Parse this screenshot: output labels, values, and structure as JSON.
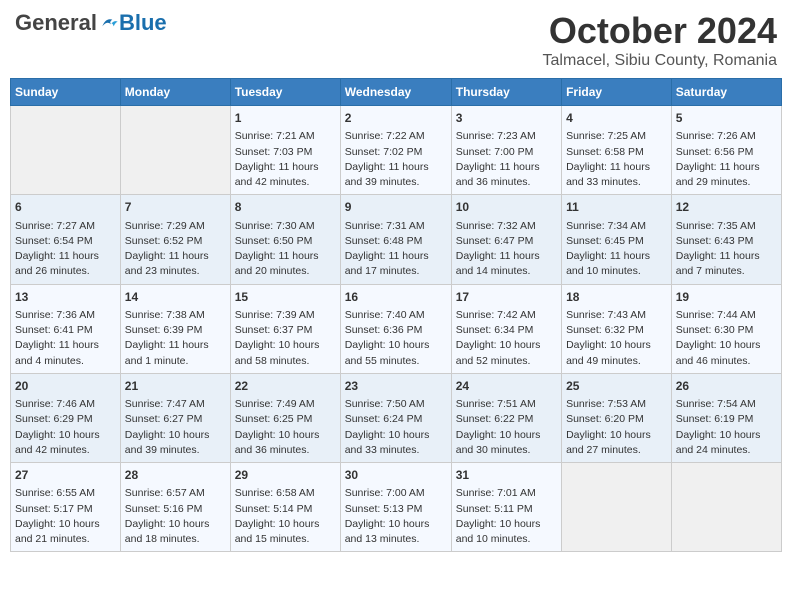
{
  "header": {
    "logo_general": "General",
    "logo_blue": "Blue",
    "month": "October 2024",
    "location": "Talmacel, Sibiu County, Romania"
  },
  "weekdays": [
    "Sunday",
    "Monday",
    "Tuesday",
    "Wednesday",
    "Thursday",
    "Friday",
    "Saturday"
  ],
  "weeks": [
    [
      {
        "day": "",
        "sunrise": "",
        "sunset": "",
        "daylight": ""
      },
      {
        "day": "",
        "sunrise": "",
        "sunset": "",
        "daylight": ""
      },
      {
        "day": "1",
        "sunrise": "Sunrise: 7:21 AM",
        "sunset": "Sunset: 7:03 PM",
        "daylight": "Daylight: 11 hours and 42 minutes."
      },
      {
        "day": "2",
        "sunrise": "Sunrise: 7:22 AM",
        "sunset": "Sunset: 7:02 PM",
        "daylight": "Daylight: 11 hours and 39 minutes."
      },
      {
        "day": "3",
        "sunrise": "Sunrise: 7:23 AM",
        "sunset": "Sunset: 7:00 PM",
        "daylight": "Daylight: 11 hours and 36 minutes."
      },
      {
        "day": "4",
        "sunrise": "Sunrise: 7:25 AM",
        "sunset": "Sunset: 6:58 PM",
        "daylight": "Daylight: 11 hours and 33 minutes."
      },
      {
        "day": "5",
        "sunrise": "Sunrise: 7:26 AM",
        "sunset": "Sunset: 6:56 PM",
        "daylight": "Daylight: 11 hours and 29 minutes."
      }
    ],
    [
      {
        "day": "6",
        "sunrise": "Sunrise: 7:27 AM",
        "sunset": "Sunset: 6:54 PM",
        "daylight": "Daylight: 11 hours and 26 minutes."
      },
      {
        "day": "7",
        "sunrise": "Sunrise: 7:29 AM",
        "sunset": "Sunset: 6:52 PM",
        "daylight": "Daylight: 11 hours and 23 minutes."
      },
      {
        "day": "8",
        "sunrise": "Sunrise: 7:30 AM",
        "sunset": "Sunset: 6:50 PM",
        "daylight": "Daylight: 11 hours and 20 minutes."
      },
      {
        "day": "9",
        "sunrise": "Sunrise: 7:31 AM",
        "sunset": "Sunset: 6:48 PM",
        "daylight": "Daylight: 11 hours and 17 minutes."
      },
      {
        "day": "10",
        "sunrise": "Sunrise: 7:32 AM",
        "sunset": "Sunset: 6:47 PM",
        "daylight": "Daylight: 11 hours and 14 minutes."
      },
      {
        "day": "11",
        "sunrise": "Sunrise: 7:34 AM",
        "sunset": "Sunset: 6:45 PM",
        "daylight": "Daylight: 11 hours and 10 minutes."
      },
      {
        "day": "12",
        "sunrise": "Sunrise: 7:35 AM",
        "sunset": "Sunset: 6:43 PM",
        "daylight": "Daylight: 11 hours and 7 minutes."
      }
    ],
    [
      {
        "day": "13",
        "sunrise": "Sunrise: 7:36 AM",
        "sunset": "Sunset: 6:41 PM",
        "daylight": "Daylight: 11 hours and 4 minutes."
      },
      {
        "day": "14",
        "sunrise": "Sunrise: 7:38 AM",
        "sunset": "Sunset: 6:39 PM",
        "daylight": "Daylight: 11 hours and 1 minute."
      },
      {
        "day": "15",
        "sunrise": "Sunrise: 7:39 AM",
        "sunset": "Sunset: 6:37 PM",
        "daylight": "Daylight: 10 hours and 58 minutes."
      },
      {
        "day": "16",
        "sunrise": "Sunrise: 7:40 AM",
        "sunset": "Sunset: 6:36 PM",
        "daylight": "Daylight: 10 hours and 55 minutes."
      },
      {
        "day": "17",
        "sunrise": "Sunrise: 7:42 AM",
        "sunset": "Sunset: 6:34 PM",
        "daylight": "Daylight: 10 hours and 52 minutes."
      },
      {
        "day": "18",
        "sunrise": "Sunrise: 7:43 AM",
        "sunset": "Sunset: 6:32 PM",
        "daylight": "Daylight: 10 hours and 49 minutes."
      },
      {
        "day": "19",
        "sunrise": "Sunrise: 7:44 AM",
        "sunset": "Sunset: 6:30 PM",
        "daylight": "Daylight: 10 hours and 46 minutes."
      }
    ],
    [
      {
        "day": "20",
        "sunrise": "Sunrise: 7:46 AM",
        "sunset": "Sunset: 6:29 PM",
        "daylight": "Daylight: 10 hours and 42 minutes."
      },
      {
        "day": "21",
        "sunrise": "Sunrise: 7:47 AM",
        "sunset": "Sunset: 6:27 PM",
        "daylight": "Daylight: 10 hours and 39 minutes."
      },
      {
        "day": "22",
        "sunrise": "Sunrise: 7:49 AM",
        "sunset": "Sunset: 6:25 PM",
        "daylight": "Daylight: 10 hours and 36 minutes."
      },
      {
        "day": "23",
        "sunrise": "Sunrise: 7:50 AM",
        "sunset": "Sunset: 6:24 PM",
        "daylight": "Daylight: 10 hours and 33 minutes."
      },
      {
        "day": "24",
        "sunrise": "Sunrise: 7:51 AM",
        "sunset": "Sunset: 6:22 PM",
        "daylight": "Daylight: 10 hours and 30 minutes."
      },
      {
        "day": "25",
        "sunrise": "Sunrise: 7:53 AM",
        "sunset": "Sunset: 6:20 PM",
        "daylight": "Daylight: 10 hours and 27 minutes."
      },
      {
        "day": "26",
        "sunrise": "Sunrise: 7:54 AM",
        "sunset": "Sunset: 6:19 PM",
        "daylight": "Daylight: 10 hours and 24 minutes."
      }
    ],
    [
      {
        "day": "27",
        "sunrise": "Sunrise: 6:55 AM",
        "sunset": "Sunset: 5:17 PM",
        "daylight": "Daylight: 10 hours and 21 minutes."
      },
      {
        "day": "28",
        "sunrise": "Sunrise: 6:57 AM",
        "sunset": "Sunset: 5:16 PM",
        "daylight": "Daylight: 10 hours and 18 minutes."
      },
      {
        "day": "29",
        "sunrise": "Sunrise: 6:58 AM",
        "sunset": "Sunset: 5:14 PM",
        "daylight": "Daylight: 10 hours and 15 minutes."
      },
      {
        "day": "30",
        "sunrise": "Sunrise: 7:00 AM",
        "sunset": "Sunset: 5:13 PM",
        "daylight": "Daylight: 10 hours and 13 minutes."
      },
      {
        "day": "31",
        "sunrise": "Sunrise: 7:01 AM",
        "sunset": "Sunset: 5:11 PM",
        "daylight": "Daylight: 10 hours and 10 minutes."
      },
      {
        "day": "",
        "sunrise": "",
        "sunset": "",
        "daylight": ""
      },
      {
        "day": "",
        "sunrise": "",
        "sunset": "",
        "daylight": ""
      }
    ]
  ]
}
